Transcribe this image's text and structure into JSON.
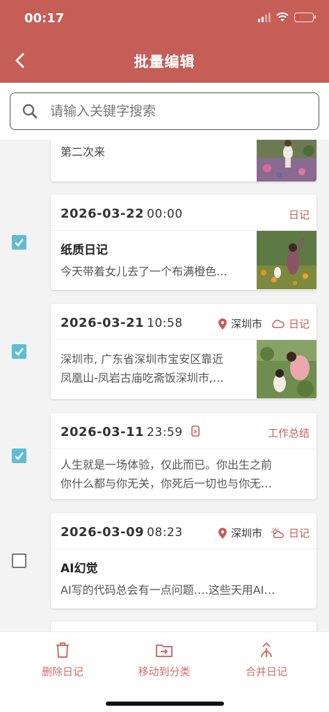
{
  "status": {
    "time": "00:17"
  },
  "header": {
    "title": "批量编辑"
  },
  "search": {
    "placeholder": "请输入关键字搜索"
  },
  "entries": [
    {
      "text": "第二次来"
    },
    {
      "date": "2026-03-22",
      "time": "00:00",
      "category": "日记",
      "title": "纸质日记",
      "text": "今天带着女儿去了一个布满橙色…",
      "checked": true
    },
    {
      "date": "2026-03-21",
      "time": "10:58",
      "location": "深圳市",
      "category": "日记",
      "line1": "深圳市, 广东省深圳市宝安区靠近",
      "line2": "凤凰山-凤岩古庙吃斋饭深圳市,…",
      "checked": true
    },
    {
      "date": "2026-03-11",
      "time": "23:59",
      "category": "工作总结",
      "line1": "人生就是一场体验，仅此而已。你出生之前",
      "line2": "你什么都与你无关，你死后一切也与你无…",
      "checked": true
    },
    {
      "date": "2026-03-09",
      "time": "08:23",
      "location": "深圳市",
      "category": "日记",
      "title": "AI幻觉",
      "text": "AI写的代码总会有一点问题….这些天用AI…",
      "checked": false
    }
  ],
  "actions": {
    "delete": "删除日记",
    "move": "移动到分类",
    "merge": "合并日记"
  },
  "colors": {
    "header": "#c45e57",
    "accent": "#d06c66",
    "checkbox": "#5fbcd3"
  }
}
